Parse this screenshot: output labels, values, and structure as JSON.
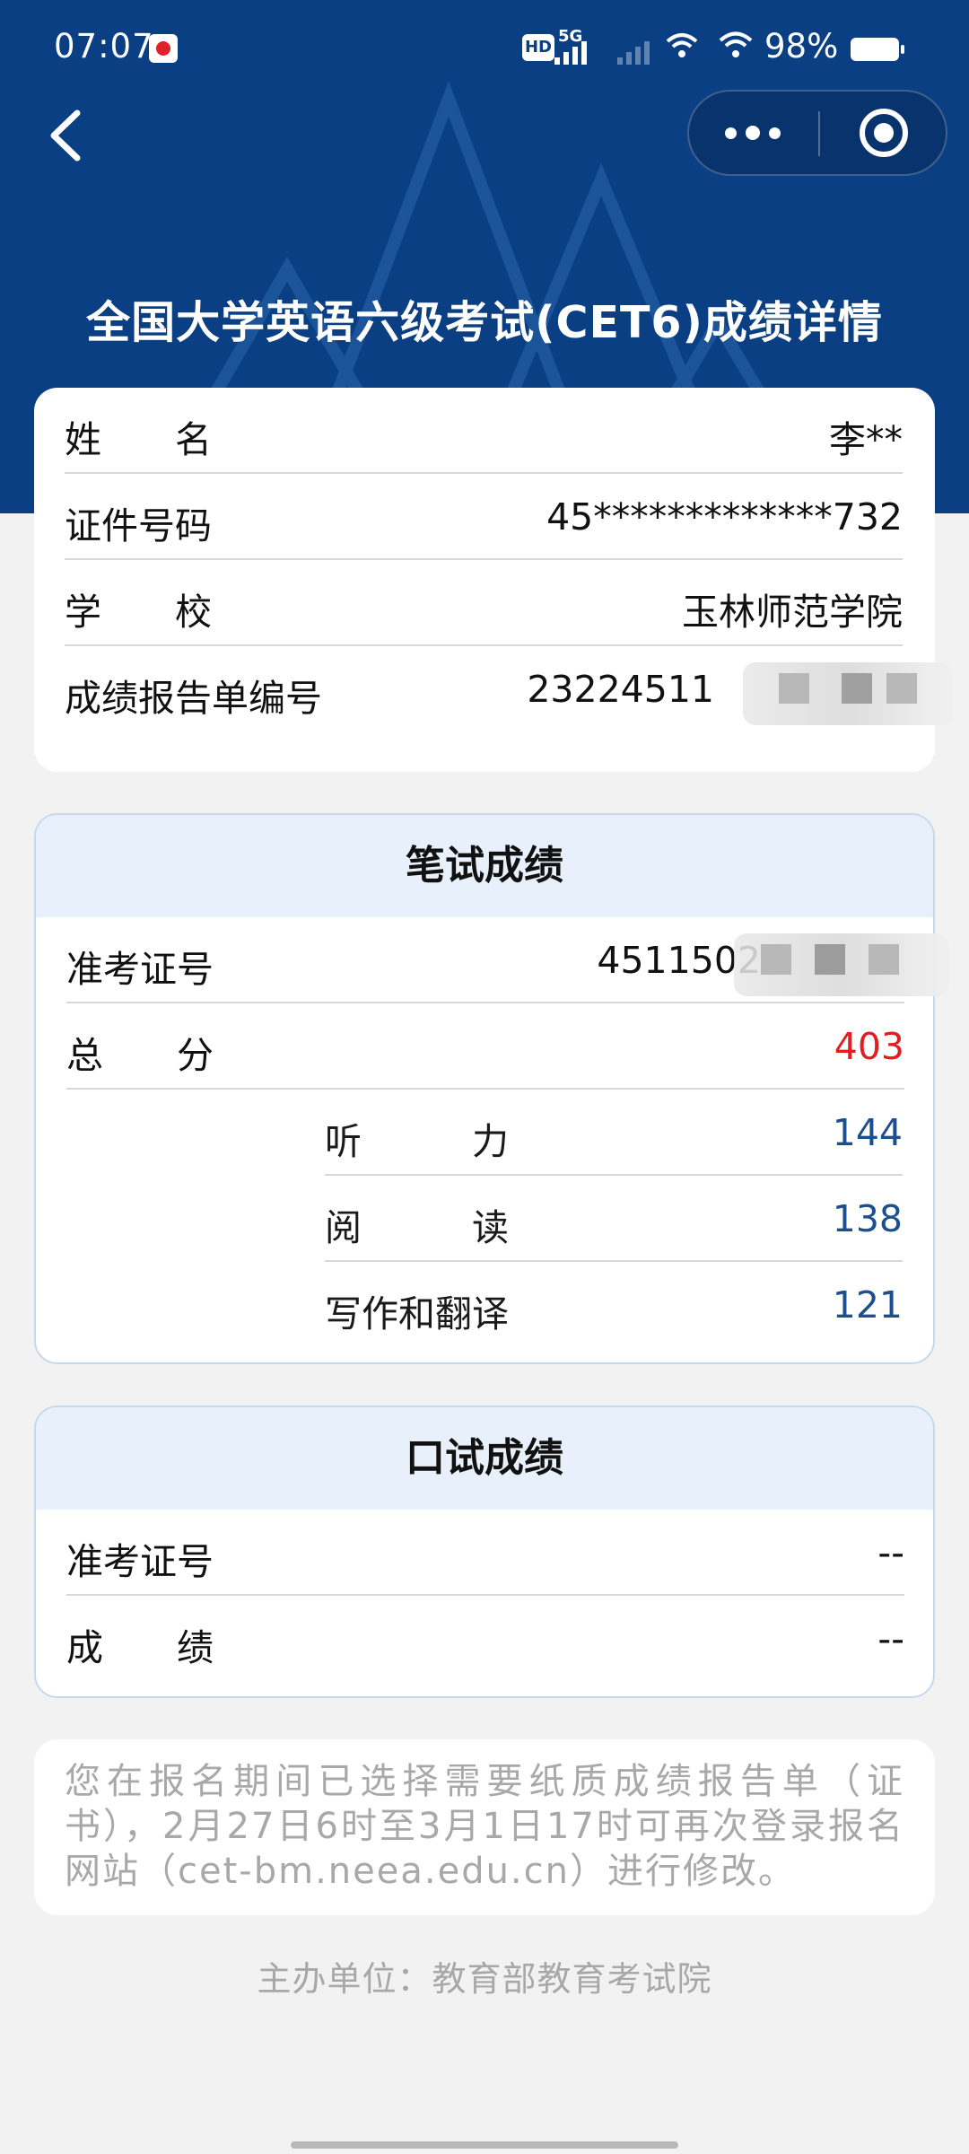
{
  "status_bar": {
    "time": "07:07",
    "hd": "HD",
    "network": "5G",
    "battery": "98%"
  },
  "nav": {
    "back_icon": "chevron-left-icon",
    "more_icon": "more-dots-icon",
    "close_icon": "target-close-icon"
  },
  "title": "全国大学英语六级考试(CET6)成绩详情",
  "info": {
    "name_label": "姓　　名",
    "name_value": "李**",
    "id_label": "证件号码",
    "id_value": "45*************732",
    "school_label": "学　　校",
    "school_value": "玉林师范学院",
    "report_label": "成绩报告单编号",
    "report_value": "23224511"
  },
  "written": {
    "header": "笔试成绩",
    "ticket_label": "准考证号",
    "ticket_value": "4511502",
    "total_label": "总　　分",
    "total_value": "403",
    "listening_label": "听　　　力",
    "listening_value": "144",
    "reading_label": "阅　　　读",
    "reading_value": "138",
    "writing_label": "写作和翻译",
    "writing_value": "121"
  },
  "oral": {
    "header": "口试成绩",
    "ticket_label": "准考证号",
    "ticket_value": "--",
    "score_label": "成　　绩",
    "score_value": "--"
  },
  "notice": "您在报名期间已选择需要纸质成绩报告单（证书），2月27日6时至3月1日17时可再次登录报名网站（cet-bm.neea.edu.cn）进行修改。",
  "footer": "主办单位：教育部教育考试院",
  "colors": {
    "header_bg": "#0b3f84",
    "total_score": "#e02020",
    "sub_score": "#1d4f8c",
    "section_head_bg": "#e8f1fb"
  }
}
